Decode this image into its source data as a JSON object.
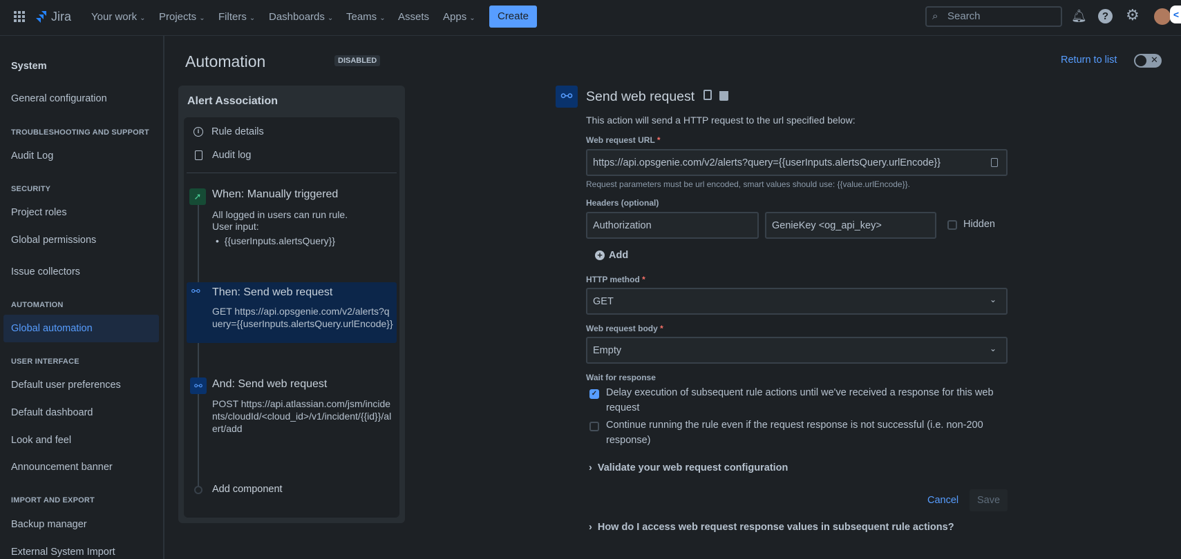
{
  "nav": {
    "app_name": "Jira",
    "items": [
      "Your work",
      "Projects",
      "Filters",
      "Dashboards",
      "Teams",
      "Assets",
      "Apps"
    ],
    "create": "Create",
    "search_placeholder": "Search"
  },
  "sidebar": {
    "title": "System",
    "general": "General configuration",
    "sections": [
      {
        "header": "TROUBLESHOOTING AND SUPPORT"
      },
      {
        "header": "SECURITY"
      },
      {
        "header": "AUTOMATION"
      },
      {
        "header": "USER INTERFACE"
      },
      {
        "header": "IMPORT AND EXPORT"
      }
    ],
    "items": {
      "audit": "Audit Log",
      "roles": "Project roles",
      "perms": "Global permissions",
      "collectors": "Issue collectors",
      "automation": "Global automation",
      "prefs": "Default user preferences",
      "dashboard": "Default dashboard",
      "look": "Look and feel",
      "banner": "Announcement banner",
      "backup": "Backup manager",
      "external": "External System Import"
    }
  },
  "page": {
    "title": "Automation",
    "status": "DISABLED",
    "return": "Return to list"
  },
  "rule": {
    "name": "Alert Association",
    "details": "Rule details",
    "audit": "Audit log",
    "when": {
      "title": "When: Manually triggered",
      "l1": "All logged in users can run rule.",
      "l2": "User input:",
      "bullet": "{{userInputs.alertsQuery}}"
    },
    "then": {
      "title": "Then: Send web request",
      "desc": "GET https://api.opsgenie.com/v2/alerts?query={{userInputs.alertsQuery.urlEncode}}"
    },
    "and": {
      "title": "And: Send web request",
      "desc": "POST https://api.atlassian.com/jsm/incidents/cloudId/<cloud_id>/v1/incident/{{id}}/alert/add"
    },
    "add": "Add component"
  },
  "form": {
    "title": "Send web request",
    "desc": "This action will send a HTTP request to the url specified below:",
    "url_label": "Web request URL",
    "url": "https://api.opsgenie.com/v2/alerts?query={{userInputs.alertsQuery.urlEncode}}",
    "url_help": "Request parameters must be url encoded, smart values should use: {{value.urlEncode}}.",
    "headers_label": "Headers (optional)",
    "header_name": "Authorization",
    "header_value": "GenieKey <og_api_key>",
    "hidden": "Hidden",
    "add": "Add",
    "method_label": "HTTP method",
    "method": "GET",
    "body_label": "Web request body",
    "body": "Empty",
    "wait_label": "Wait for response",
    "delay": "Delay execution of subsequent rule actions until we've received a response for this web request",
    "delay_checked": true,
    "continue": "Continue running the rule even if the request response is not successful (i.e. non-200 response)",
    "continue_checked": false,
    "validate": "Validate your web request configuration",
    "cancel": "Cancel",
    "save": "Save",
    "howto": "How do I access web request response values in subsequent rule actions?"
  },
  "colors": {
    "accent": "#579dff",
    "active_bg": "#1c2b41"
  }
}
